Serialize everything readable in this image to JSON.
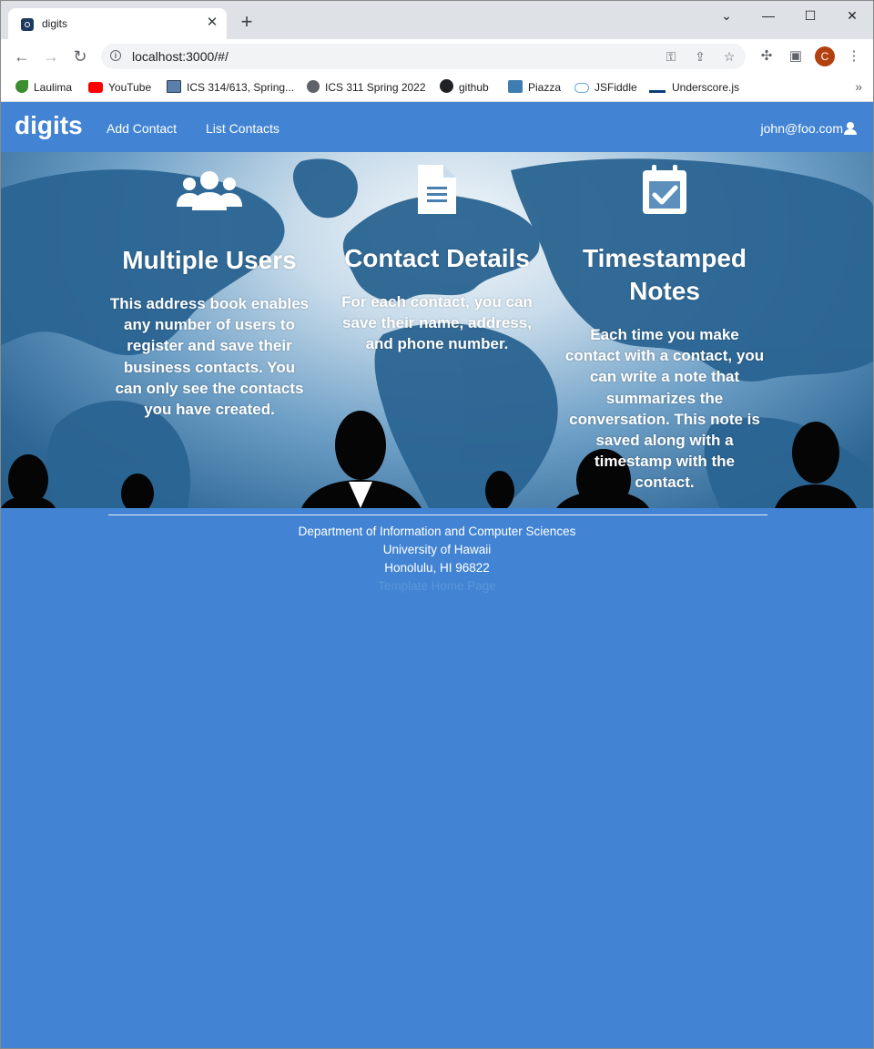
{
  "browser": {
    "tab_title": "digits",
    "tab_close": "✕",
    "new_tab": "+",
    "url": "localhost:3000/#/",
    "profile_initial": "C",
    "window_controls": [
      "⌄",
      "—",
      "☐",
      "✕"
    ],
    "bookmarks": [
      {
        "label": "Laulima",
        "color": "#3c8d2f"
      },
      {
        "label": "YouTube",
        "color": "#ff0000"
      },
      {
        "label": "ICS 314/613, Spring...",
        "color": "#5b7fa8"
      },
      {
        "label": "ICS 311 Spring 2022",
        "color": "#5f6368"
      },
      {
        "label": "github",
        "color": "#202124"
      },
      {
        "label": "Piazza",
        "color": "#3e7cb1"
      },
      {
        "label": "JSFiddle",
        "color": "#6aa7de"
      },
      {
        "label": "Underscore.js",
        "color": "#0a3c78"
      }
    ],
    "bookmarks_more": "»"
  },
  "navbar": {
    "brand": "digits",
    "links": [
      "Add Contact",
      "List Contacts"
    ],
    "user": "john@foo.com",
    "background": "#4284d3"
  },
  "features": [
    {
      "icon": "users-icon",
      "title": "Multiple Users",
      "text": "This address book enables any number of users to register and save their business contacts. You can only see the contacts you have created."
    },
    {
      "icon": "file-icon",
      "title": "Contact Details",
      "text": "For each contact, you can save their name, address, and phone number."
    },
    {
      "icon": "calendar-check-icon",
      "title": "Timestamped Notes",
      "text": "Each time you make contact with a contact, you can write a note that summarizes the conversation. This note is saved along with a timestamp with the contact."
    }
  ],
  "footer": {
    "lines": [
      "Department of Information and Computer Sciences",
      "University of Hawaii",
      "Honolulu, HI 96822"
    ],
    "faint_line": "Template Home Page"
  }
}
